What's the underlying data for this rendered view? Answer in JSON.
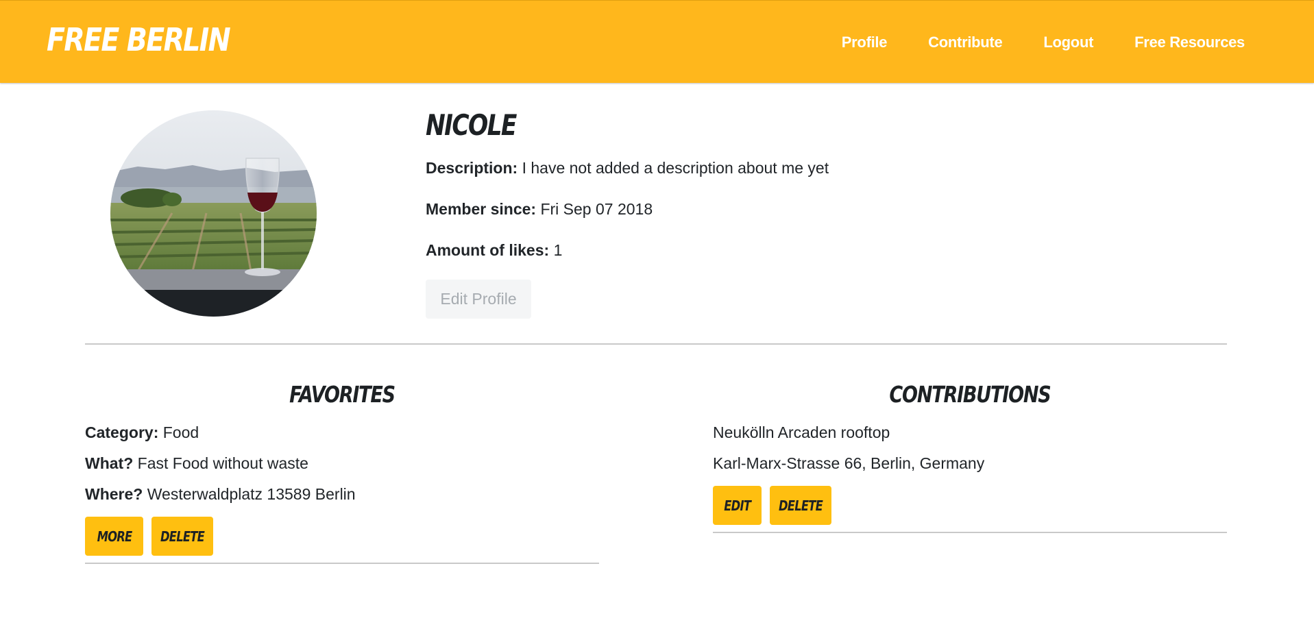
{
  "brand": "Free Berlin",
  "nav": {
    "links": [
      "Profile",
      "Contribute",
      "Logout",
      "Free Resources"
    ]
  },
  "profile": {
    "name": "Nicole",
    "avatar_icon": "wine-glass-vineyard-photo",
    "description_label": "Description:",
    "description_value": "I have not added a description about me yet",
    "member_since_label": "Member since:",
    "member_since_value": "Fri Sep 07 2018",
    "likes_label": "Amount of likes:",
    "likes_value": "1",
    "edit_button": "Edit Profile"
  },
  "favorites": {
    "title": "Favorites",
    "items": [
      {
        "category_label": "Category:",
        "category_value": "Food",
        "what_label": "What?",
        "what_value": "Fast Food without waste",
        "where_label": "Where?",
        "where_value": "Westerwaldplatz 13589 Berlin",
        "more_button": "More",
        "delete_button": "Delete"
      }
    ]
  },
  "contributions": {
    "title": "Contributions",
    "items": [
      {
        "name": "Neukölln Arcaden rooftop",
        "address": "Karl-Marx-Strasse 66, Berlin, Germany",
        "edit_button": "Edit",
        "delete_button": "Delete"
      }
    ]
  },
  "colors": {
    "brand_yellow": "#ffb71c",
    "button_yellow": "#ffbf10",
    "text_dark": "#212529"
  }
}
